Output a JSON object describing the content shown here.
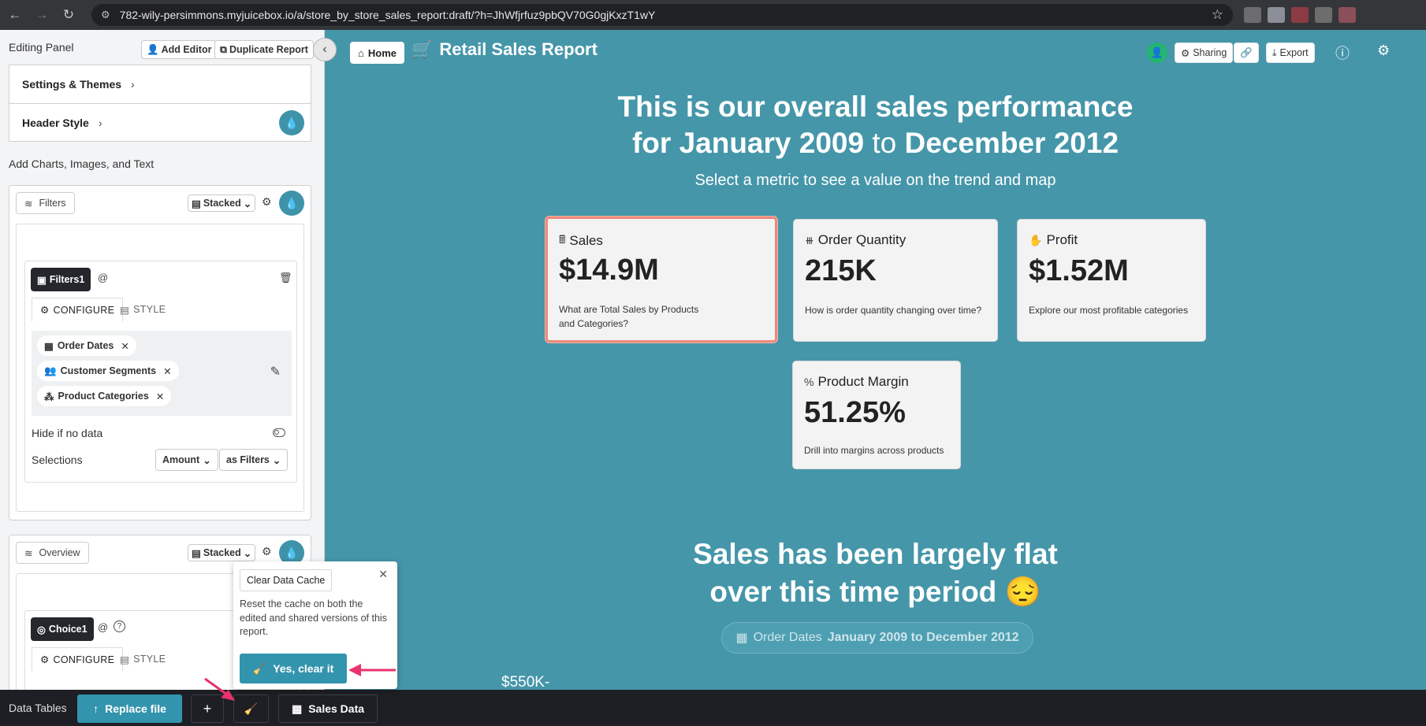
{
  "browser": {
    "url": "782-wily-persimmons.myjuicebox.io/a/store_by_store_sales_report:draft/?h=JhWfjrfuz9pbQV70G0gjKxzT1wY"
  },
  "left_panel": {
    "title": "Editing Panel",
    "add_editor": "Add Editor",
    "duplicate_report": "Duplicate Report",
    "settings_themes": "Settings & Themes",
    "header_style": "Header Style",
    "add_section_label": "Add Charts, Images, and Text",
    "filters_block": {
      "tag": "Filters",
      "layout": "Stacked",
      "chip": "Filters1",
      "at": "@",
      "tabs": [
        "CONFIGURE",
        "STYLE"
      ],
      "pills": [
        "Order Dates",
        "Customer Segments",
        "Product Categories"
      ],
      "hide_label": "Hide if no data",
      "selections_label": "Selections",
      "amount": "Amount",
      "as_filters": "as Filters"
    },
    "overview_block": {
      "tag": "Overview",
      "layout": "Stacked",
      "chip": "Choice1",
      "at": "@",
      "tabs": [
        "CONFIGURE",
        "STYLE"
      ]
    }
  },
  "main": {
    "home": "Home",
    "report_title": "Retail Sales Report",
    "sharing": "Sharing",
    "export": "Export",
    "headline_line1": "This is our overall sales performance",
    "headline_line2_a": "for January 2009",
    "headline_line2_b": "to",
    "headline_line2_c": "December 2012",
    "subline": "Select a metric to see a value on the trend and map",
    "metrics": [
      {
        "title": "Sales",
        "value": "$14.9M",
        "desc1": "What are Total Sales by Products",
        "desc2": "and Categories?",
        "selected": true
      },
      {
        "title": "Order Quantity",
        "value": "215K",
        "desc1": "How is order quantity changing over time?",
        "desc2": ""
      },
      {
        "title": "Profit",
        "value": "$1.52M",
        "desc1": "Explore our most profitable categories",
        "desc2": ""
      },
      {
        "title": "Product Margin",
        "value": "51.25%",
        "desc1": "Drill into margins across products",
        "desc2": ""
      }
    ],
    "section2_line1": "Sales has been largely flat",
    "section2_line2": "over this time period 😔",
    "date_pill_label": "Order Dates",
    "date_pill_value": "January 2009 to December 2012",
    "axis_partial": "$550K-"
  },
  "popover": {
    "title": "Clear Data Cache",
    "text": "Reset the cache on both the edited and shared versions of this report.",
    "button": "Yes, clear it"
  },
  "bottom_bar": {
    "label": "Data Tables",
    "replace": "Replace file",
    "sales_data": "Sales Data"
  },
  "colors": {
    "main_bg": "#4596a9",
    "accent": "#3394ad",
    "selected_border": "#ec8a7c",
    "arrow": "#e8336d"
  }
}
